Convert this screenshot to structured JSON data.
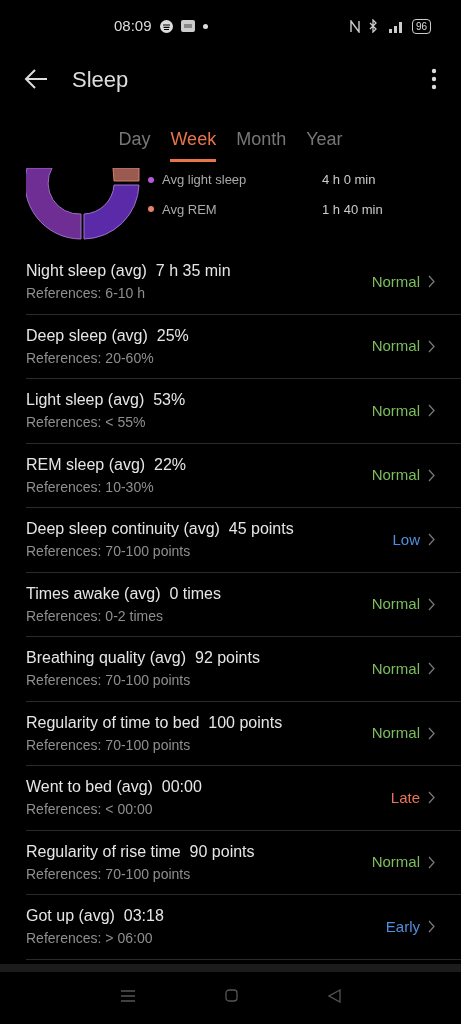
{
  "status_bar": {
    "time": "08:09",
    "battery": "96"
  },
  "header": {
    "title": "Sleep"
  },
  "tabs": [
    {
      "label": "Day",
      "selected": false
    },
    {
      "label": "Week",
      "selected": true
    },
    {
      "label": "Month",
      "selected": false
    },
    {
      "label": "Year",
      "selected": false
    }
  ],
  "legend": [
    {
      "label": "Avg light sleep",
      "value": "4 h 0 min",
      "color": "#b45ad8"
    },
    {
      "label": "Avg REM",
      "value": "1 h 40 min",
      "color": "#e8806e"
    }
  ],
  "metrics": [
    {
      "title": "Night sleep (avg)",
      "value": "7 h 35 min",
      "reference": "References: 6-10 h",
      "status": "Normal",
      "color": "#7dbd5e"
    },
    {
      "title": "Deep sleep (avg)",
      "value": "25%",
      "reference": "References: 20-60%",
      "status": "Normal",
      "color": "#7dbd5e"
    },
    {
      "title": "Light sleep (avg)",
      "value": "53%",
      "reference": "References: < 55%",
      "status": "Normal",
      "color": "#7dbd5e"
    },
    {
      "title": "REM sleep (avg)",
      "value": "22%",
      "reference": "References: 10-30%",
      "status": "Normal",
      "color": "#7dbd5e"
    },
    {
      "title": "Deep sleep continuity (avg)",
      "value": "45 points",
      "reference": "References: 70-100 points",
      "status": "Low",
      "color": "#4f8fe0"
    },
    {
      "title": "Times awake (avg)",
      "value": "0 times",
      "reference": "References: 0-2 times",
      "status": "Normal",
      "color": "#7dbd5e"
    },
    {
      "title": "Breathing quality (avg)",
      "value": "92 points",
      "reference": "References: 70-100 points",
      "status": "Normal",
      "color": "#7dbd5e"
    },
    {
      "title": "Regularity of time to bed",
      "value": "100 points",
      "reference": "References: 70-100 points",
      "status": "Normal",
      "color": "#7dbd5e"
    },
    {
      "title": "Went to bed (avg)",
      "value": "00:00",
      "reference": "References: < 00:00",
      "status": "Late",
      "color": "#e8735a"
    },
    {
      "title": "Regularity of rise time",
      "value": "90 points",
      "reference": "References: 70-100 points",
      "status": "Normal",
      "color": "#7dbd5e"
    },
    {
      "title": "Got up (avg)",
      "value": "03:18",
      "reference": "References: > 06:00",
      "status": "Early",
      "color": "#4f8fe0"
    }
  ]
}
